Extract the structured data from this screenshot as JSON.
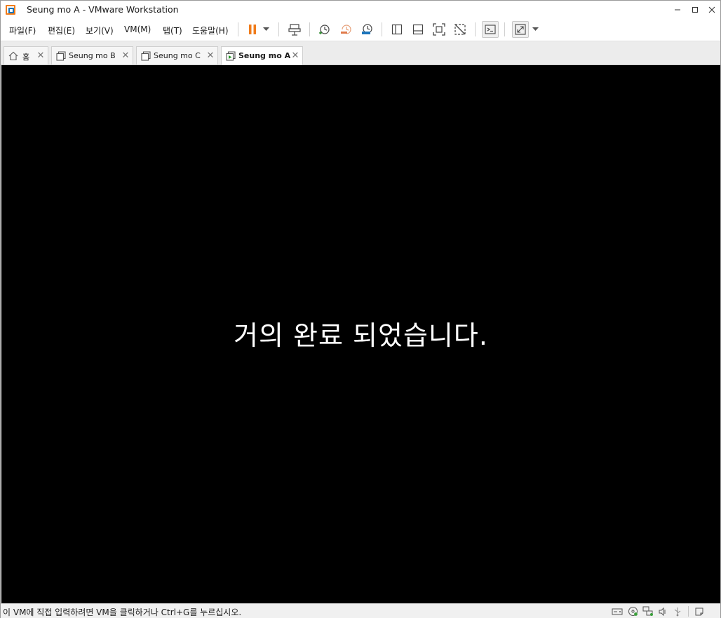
{
  "window": {
    "title": "Seung mo A - VMware Workstation",
    "controls": {
      "minimize": "–",
      "maximize": "□",
      "close": "✕"
    },
    "accent_color": "#f07c1b"
  },
  "menu": {
    "items": [
      {
        "label": "파일(F)"
      },
      {
        "label": "편집(E)"
      },
      {
        "label": "보기(V)"
      },
      {
        "label": "VM(M)"
      },
      {
        "label": "탭(T)"
      },
      {
        "label": "도움말(H)"
      }
    ]
  },
  "toolbar": {
    "buttons": [
      {
        "icon": "pause-icon"
      },
      {
        "icon": "dropdown-arrow-icon"
      },
      {
        "icon": "send-ctrl-alt-del-icon"
      },
      {
        "icon": "snapshot-take-icon"
      },
      {
        "icon": "snapshot-revert-icon"
      },
      {
        "icon": "snapshot-manager-icon"
      },
      {
        "icon": "show-library-icon"
      },
      {
        "icon": "thumbnail-bar-icon"
      },
      {
        "icon": "full-screen-icon"
      },
      {
        "icon": "unity-icon"
      },
      {
        "icon": "console-view-icon"
      },
      {
        "icon": "stretch-guest-icon"
      },
      {
        "icon": "dropdown-arrow-icon"
      }
    ]
  },
  "tabs": [
    {
      "label": "홈",
      "icon": "home-icon",
      "active": false
    },
    {
      "label": "Seung mo B",
      "icon": "vm-icon",
      "active": false
    },
    {
      "label": "Seung mo C",
      "icon": "vm-icon",
      "active": false
    },
    {
      "label": "Seung mo A",
      "icon": "vm-running-icon",
      "active": true
    }
  ],
  "vm_screen": {
    "message": "거의 완료 되었습니다.",
    "background": "#000000"
  },
  "statusbar": {
    "text": "이 VM에 직접 입력하려면 VM을 클릭하거나 Ctrl+G를 누르십시오.",
    "icons": [
      "hard-disk-icon",
      "cd-dvd-icon",
      "network-adapter-icon",
      "sound-card-icon",
      "usb-icon",
      "message-log-icon"
    ]
  }
}
